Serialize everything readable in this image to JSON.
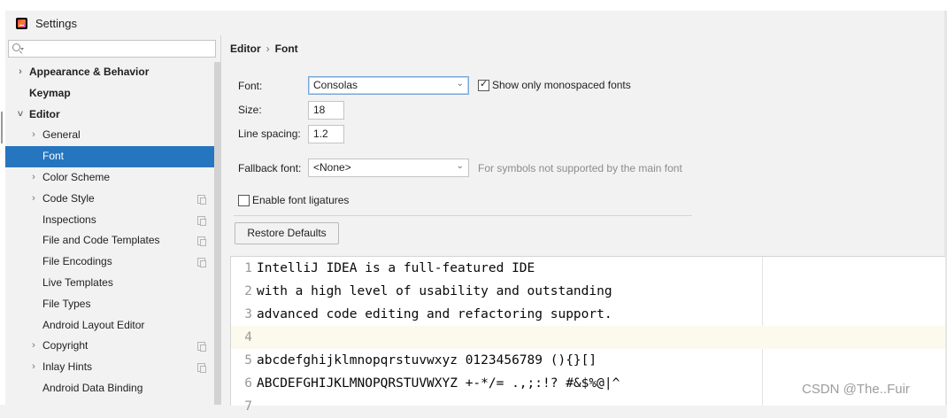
{
  "window": {
    "title": "Settings"
  },
  "search": {
    "placeholder": ""
  },
  "sidebar": {
    "items": [
      {
        "label": "Appearance & Behavior",
        "arrow": ">",
        "bold": true,
        "indent": 0,
        "copy": false
      },
      {
        "label": "Keymap",
        "arrow": "",
        "bold": true,
        "indent": 0,
        "copy": false
      },
      {
        "label": "Editor",
        "arrow": "v",
        "bold": true,
        "indent": 0,
        "copy": false
      },
      {
        "label": "General",
        "arrow": ">",
        "bold": false,
        "indent": 1,
        "copy": false
      },
      {
        "label": "Font",
        "arrow": "",
        "bold": false,
        "indent": 1,
        "copy": false,
        "selected": true
      },
      {
        "label": "Color Scheme",
        "arrow": ">",
        "bold": false,
        "indent": 1,
        "copy": false
      },
      {
        "label": "Code Style",
        "arrow": ">",
        "bold": false,
        "indent": 1,
        "copy": true
      },
      {
        "label": "Inspections",
        "arrow": "",
        "bold": false,
        "indent": 1,
        "copy": true
      },
      {
        "label": "File and Code Templates",
        "arrow": "",
        "bold": false,
        "indent": 1,
        "copy": true
      },
      {
        "label": "File Encodings",
        "arrow": "",
        "bold": false,
        "indent": 1,
        "copy": true
      },
      {
        "label": "Live Templates",
        "arrow": "",
        "bold": false,
        "indent": 1,
        "copy": false
      },
      {
        "label": "File Types",
        "arrow": "",
        "bold": false,
        "indent": 1,
        "copy": false
      },
      {
        "label": "Android Layout Editor",
        "arrow": "",
        "bold": false,
        "indent": 1,
        "copy": false
      },
      {
        "label": "Copyright",
        "arrow": ">",
        "bold": false,
        "indent": 1,
        "copy": true
      },
      {
        "label": "Inlay Hints",
        "arrow": ">",
        "bold": false,
        "indent": 1,
        "copy": true
      },
      {
        "label": "Android Data Binding",
        "arrow": "",
        "bold": false,
        "indent": 1,
        "copy": false
      }
    ]
  },
  "breadcrumb": {
    "parent": "Editor",
    "separator": "›",
    "current": "Font"
  },
  "font_settings": {
    "font_label": "Font:",
    "font_value": "Consolas",
    "mono_only_label": "Show only monospaced fonts",
    "mono_only_checked": true,
    "size_label": "Size:",
    "size_value": "18",
    "line_spacing_label": "Line spacing:",
    "line_spacing_value": "1.2",
    "fallback_label": "Fallback font:",
    "fallback_value": "<None>",
    "fallback_hint": "For symbols not supported by the main font",
    "ligatures_label": "Enable font ligatures",
    "ligatures_checked": false,
    "restore_label": "Restore Defaults"
  },
  "preview": {
    "lines": [
      {
        "n": "1",
        "text": "IntelliJ IDEA is a full-featured IDE"
      },
      {
        "n": "2",
        "text": "with a high level of usability and outstanding"
      },
      {
        "n": "3",
        "text": "advanced code editing and refactoring support."
      },
      {
        "n": "4",
        "text": "",
        "current": true
      },
      {
        "n": "5",
        "text": "abcdefghijklmnopqrstuvwxyz 0123456789 (){}[]"
      },
      {
        "n": "6",
        "text": "ABCDEFGHIJKLMNOPQRSTUVWXYZ +-*/= .,;:!? #&$%@|^"
      },
      {
        "n": "7",
        "text": ""
      }
    ]
  },
  "watermark": "CSDN @The..Fuir",
  "colors": {
    "selection": "#2675bf",
    "current_line": "#fcfaed",
    "background": "#f2f2f2"
  }
}
